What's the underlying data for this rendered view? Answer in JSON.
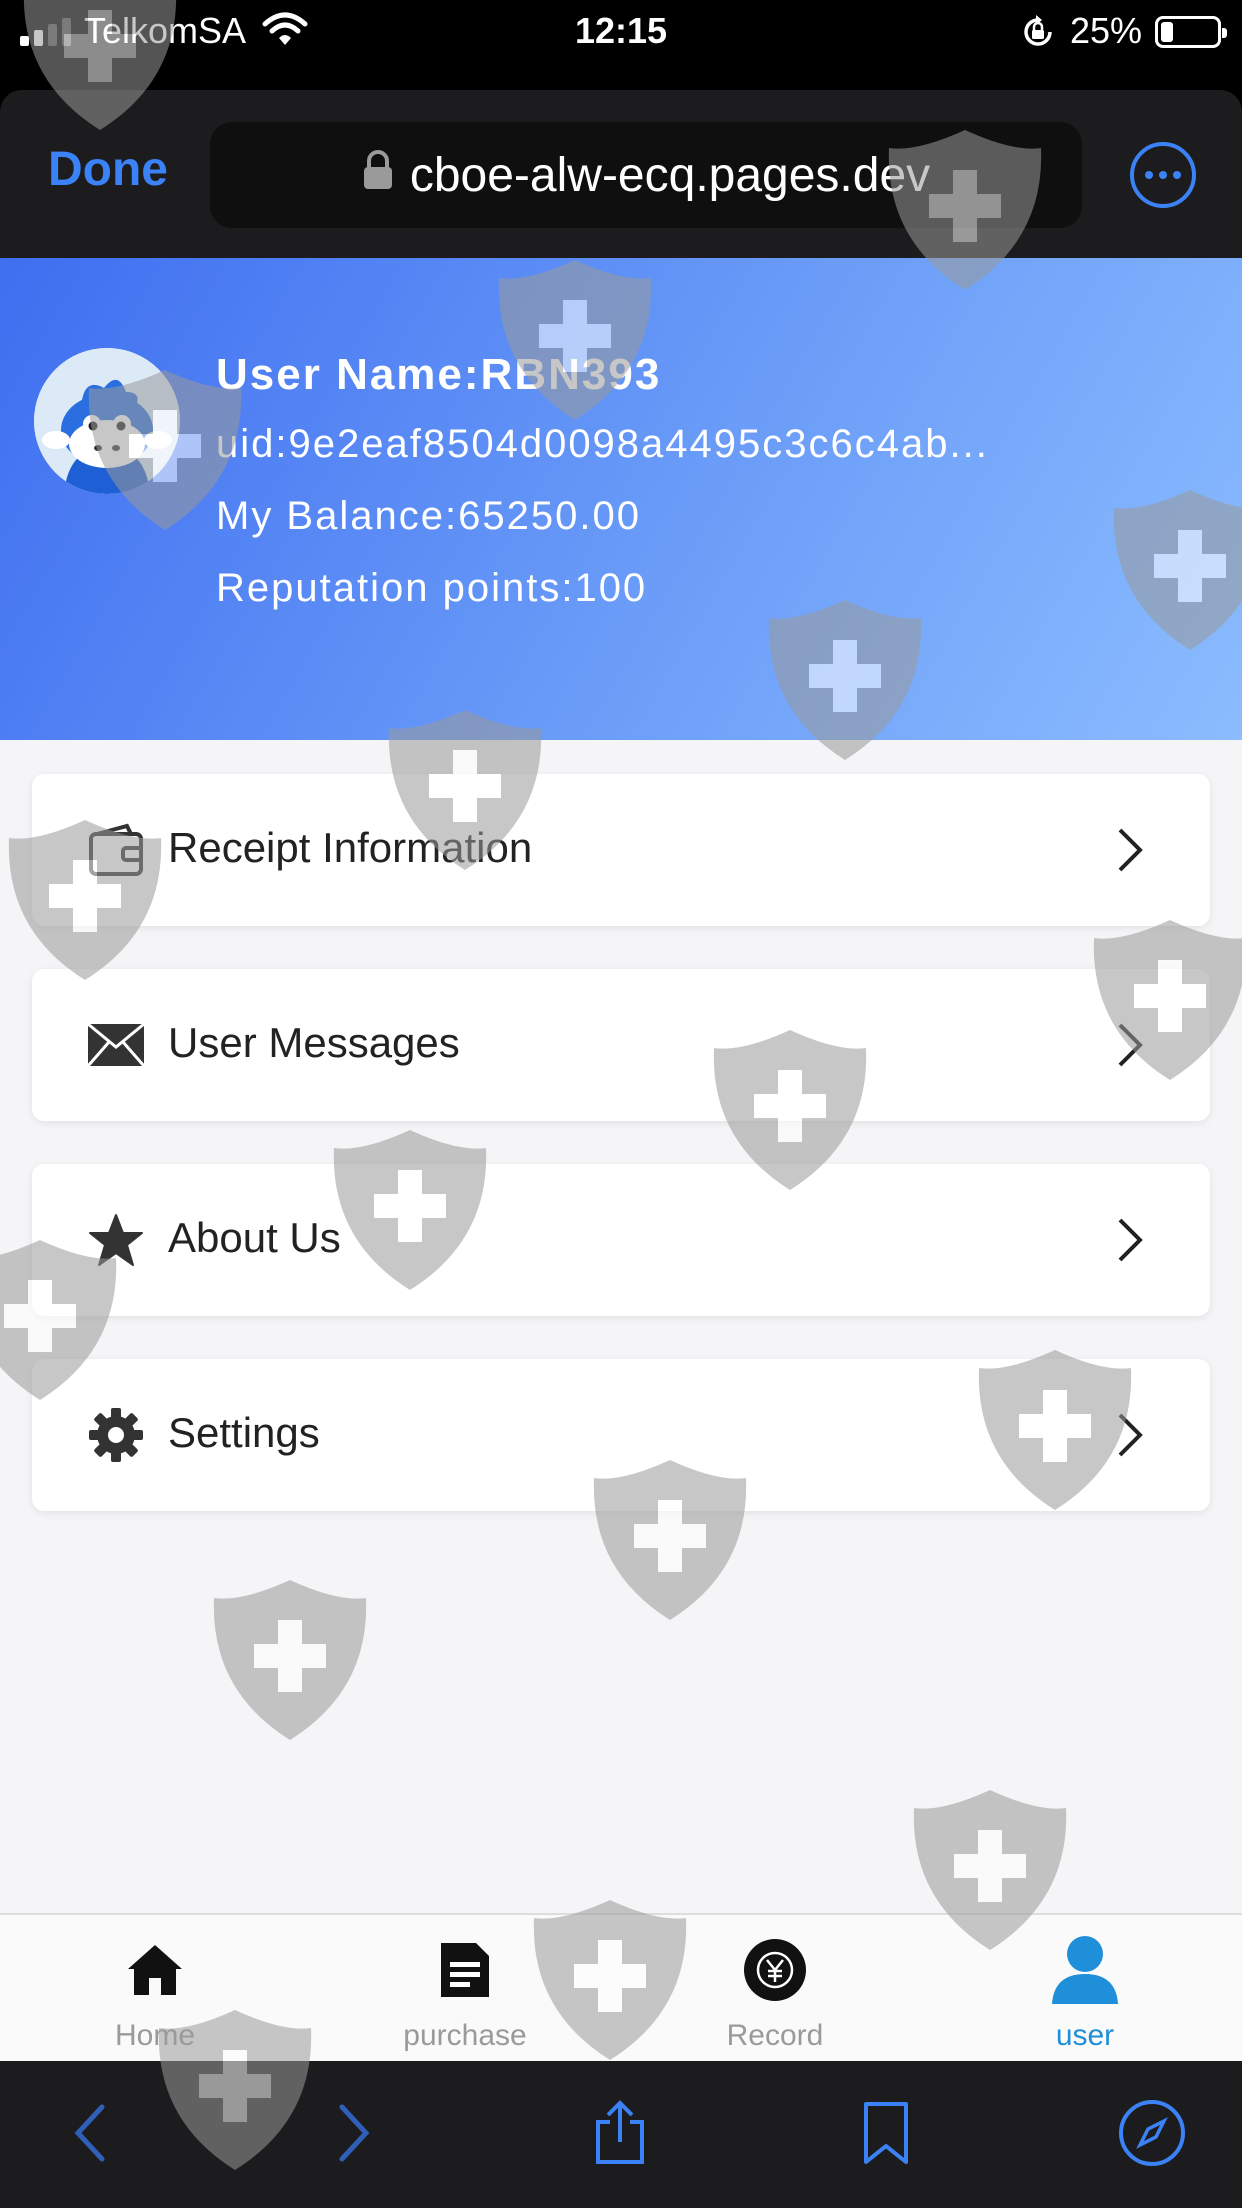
{
  "status_bar": {
    "carrier": "TelkomSA",
    "time": "12:15",
    "battery_percent": "25%",
    "icons": [
      "signal-icon",
      "wifi-icon",
      "rotation-lock-icon",
      "battery-icon"
    ]
  },
  "browser": {
    "done_label": "Done",
    "url": "cboe-alw-ecq.pages.dev",
    "accent_color": "#3b82f6",
    "toolbar_icons": [
      "back-icon",
      "forward-icon",
      "share-icon",
      "bookmarks-icon",
      "compass-icon"
    ]
  },
  "profile": {
    "user_name": "User Name:RBN393",
    "uid": "uid:9e2eaf8504d0098a4495c3c6c4ab...",
    "balance": "My Balance:65250.00",
    "reputation": "Reputation points:100",
    "header_color": "#4f7ef2"
  },
  "menu": [
    {
      "label": "Receipt Information",
      "icon": "wallet-icon"
    },
    {
      "label": "User Messages",
      "icon": "envelope-icon"
    },
    {
      "label": "About Us",
      "icon": "star-icon"
    },
    {
      "label": "Settings",
      "icon": "gear-icon"
    }
  ],
  "tabs": [
    {
      "label": "Home",
      "icon": "home-icon",
      "active": false
    },
    {
      "label": "purchase",
      "icon": "document-icon",
      "active": false
    },
    {
      "label": "Record",
      "icon": "record-icon",
      "active": false
    },
    {
      "label": "user",
      "icon": "user-icon",
      "active": true
    }
  ],
  "active_tab_color": "#1e8fd8"
}
